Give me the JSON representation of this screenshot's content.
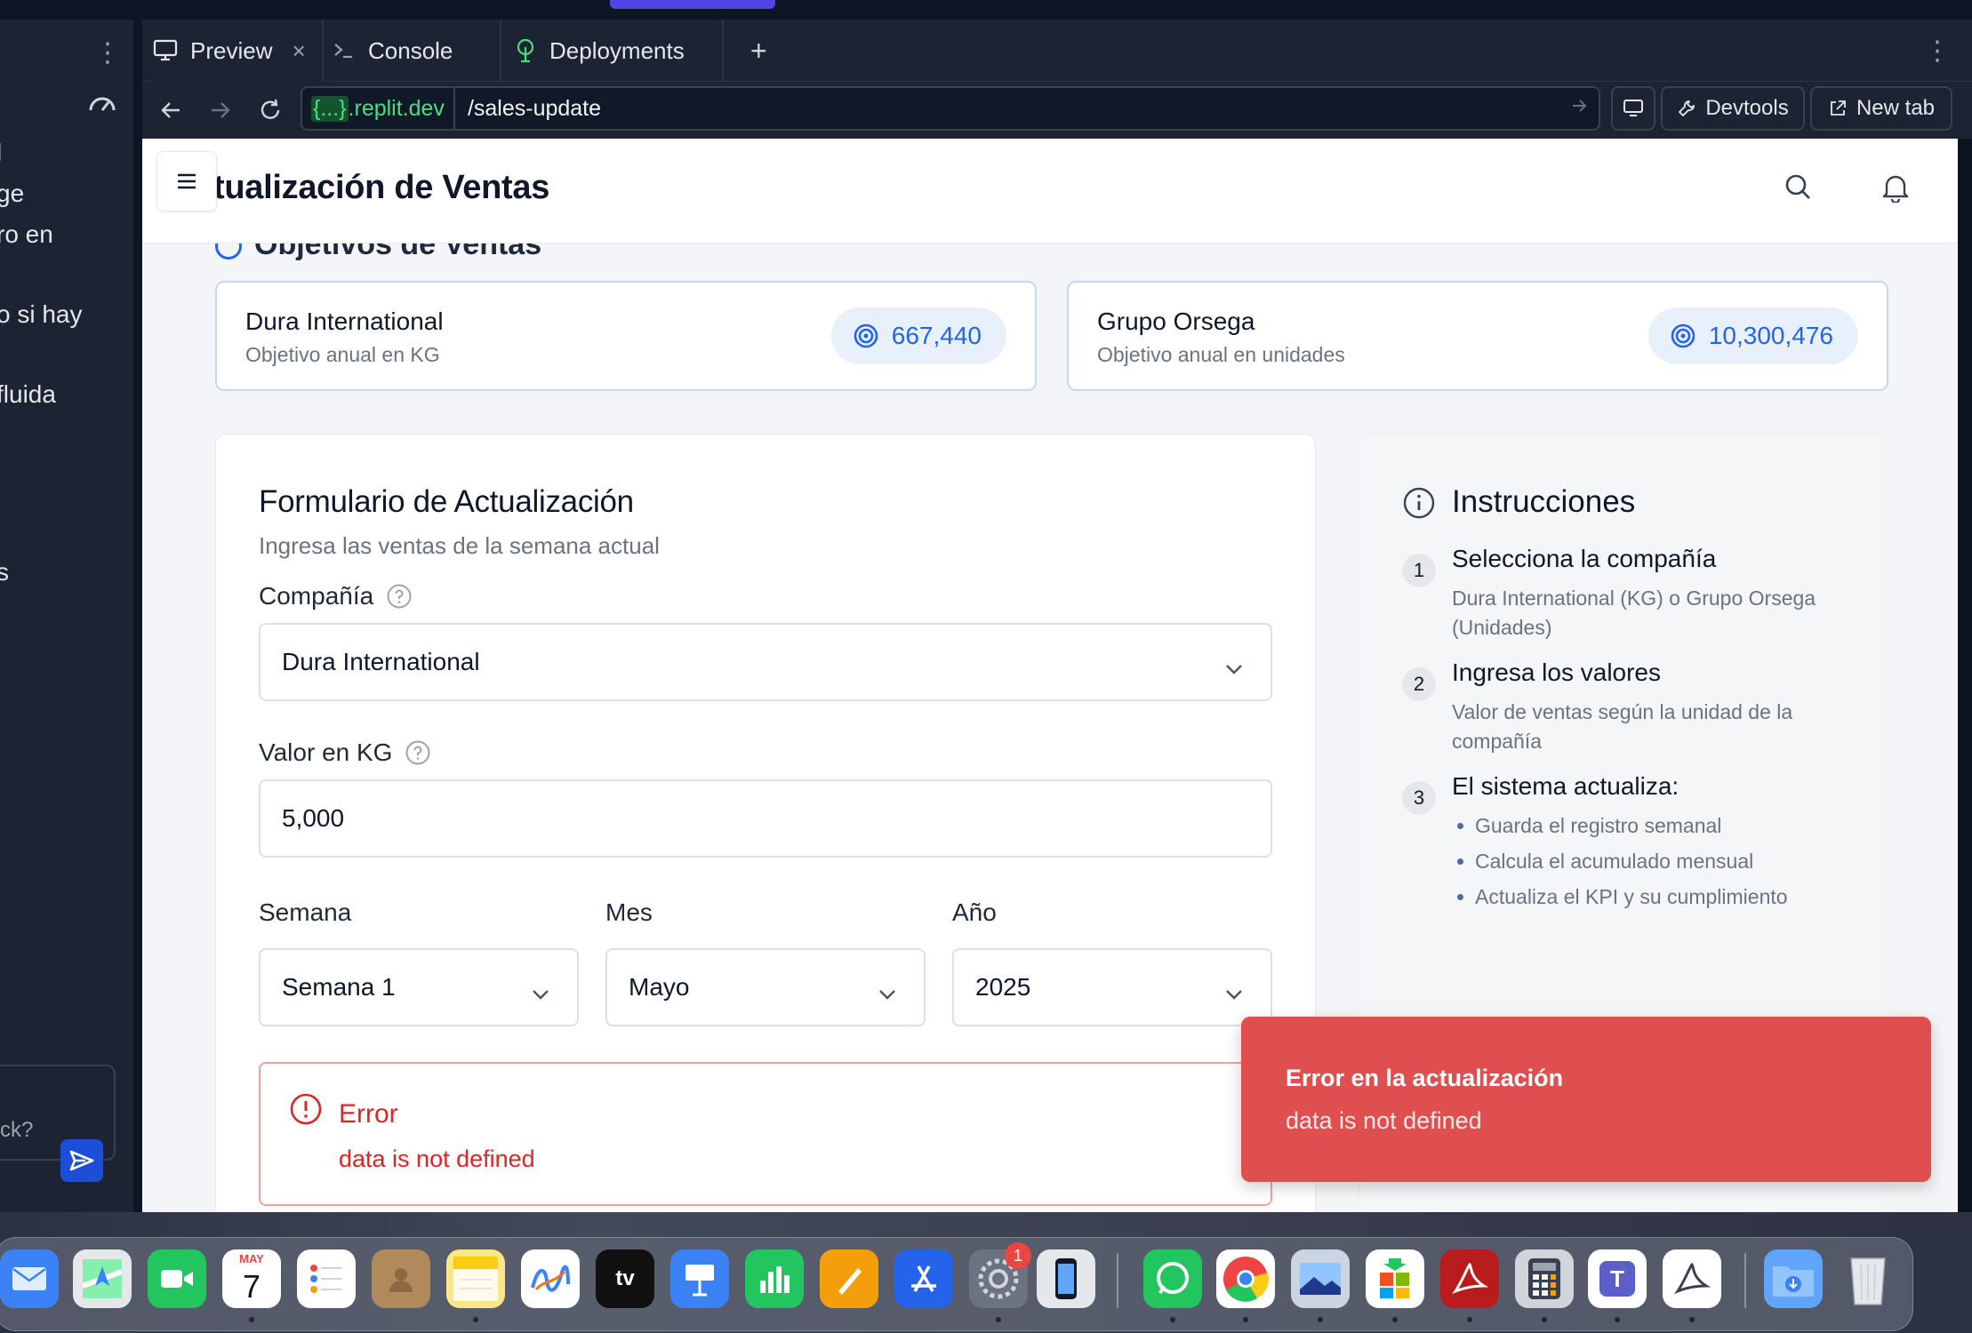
{
  "left_panel": {
    "lines": [
      "l",
      "ge",
      "ro en",
      "o si hay",
      "fluida",
      "s"
    ],
    "chat_placeholder": "ck?"
  },
  "tabs": {
    "preview": "Preview",
    "console": "Console",
    "deployments": "Deployments",
    "close": "×",
    "add": "+"
  },
  "address": {
    "host_prefix": "{...}",
    "host_suffix": ".replit.dev",
    "path": "/sales-update",
    "devtools_label": "Devtools",
    "newtab_label": "New tab"
  },
  "app": {
    "title": "tualización de Ventas",
    "section_title_cut": "Objetivos de Ventas"
  },
  "kpis": [
    {
      "company": "Dura International",
      "subtitle": "Objetivo anual en KG",
      "value": "667,440"
    },
    {
      "company": "Grupo Orsega",
      "subtitle": "Objetivo anual en unidades",
      "value": "10,300,476"
    }
  ],
  "form": {
    "title": "Formulario de Actualización",
    "subtitle": "Ingresa las ventas de la semana actual",
    "company_label": "Compañía",
    "company_value": "Dura International",
    "value_label": "Valor en KG",
    "value_value": "5,000",
    "week_label": "Semana",
    "week_value": "Semana 1",
    "month_label": "Mes",
    "month_value": "Mayo",
    "year_label": "Año",
    "year_value": "2025",
    "error_title": "Error",
    "error_message": "data is not defined"
  },
  "instructions": {
    "title": "Instrucciones",
    "steps": [
      {
        "num": "1",
        "title": "Selecciona la compañía",
        "desc": "Dura International (KG) o Grupo Orsega (Unidades)"
      },
      {
        "num": "2",
        "title": "Ingresa los valores",
        "desc": "Valor de ventas según la unidad de la compañía"
      },
      {
        "num": "3",
        "title": "El sistema actualiza:",
        "bullets": [
          "Guarda el registro semanal",
          "Calcula el acumulado mensual",
          "Actualiza el KPI y su cumplimiento"
        ]
      }
    ]
  },
  "toast": {
    "title": "Error en la actualización",
    "message": "data is not defined"
  },
  "dock": {
    "calendar_month": "MAY",
    "calendar_day": "7",
    "tv_label": "tv",
    "settings_badge": "1",
    "teams_letter": "T",
    "colors": {
      "accent": "#2563eb",
      "error": "#dc2626",
      "toast": "#e04f4f"
    }
  }
}
